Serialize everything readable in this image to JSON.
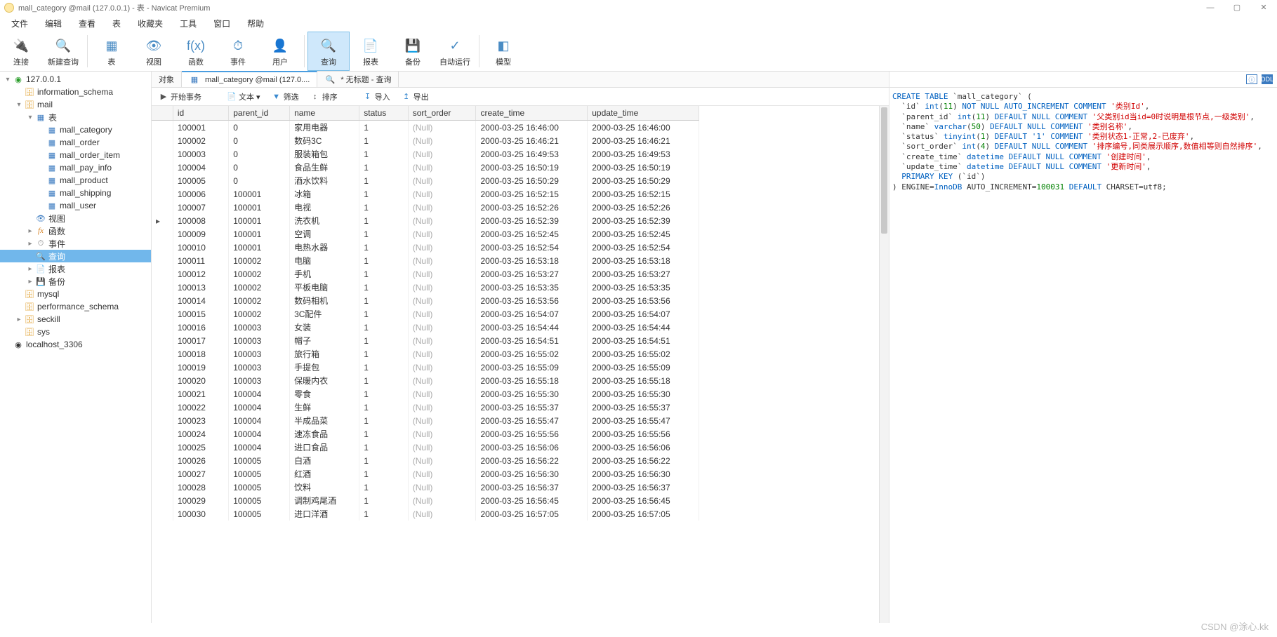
{
  "title": "mall_category @mail (127.0.0.1) - 表 - Navicat Premium",
  "menu": [
    "文件",
    "编辑",
    "查看",
    "表",
    "收藏夹",
    "工具",
    "窗口",
    "帮助"
  ],
  "toolbarBtns": [
    {
      "label": "连接",
      "icon": "🔌",
      "sel": false
    },
    {
      "label": "新建查询",
      "icon": "🔍",
      "sel": false
    },
    {
      "label": "表",
      "icon": "▦",
      "sel": false
    },
    {
      "label": "视图",
      "icon": "👁",
      "sel": false
    },
    {
      "label": "函数",
      "icon": "f(x)",
      "sel": false
    },
    {
      "label": "事件",
      "icon": "⏱",
      "sel": false
    },
    {
      "label": "用户",
      "icon": "👤",
      "sel": false
    },
    {
      "label": "查询",
      "icon": "🔍",
      "sel": true
    },
    {
      "label": "报表",
      "icon": "📄",
      "sel": false
    },
    {
      "label": "备份",
      "icon": "💾",
      "sel": false
    },
    {
      "label": "自动运行",
      "icon": "✓",
      "sel": false
    },
    {
      "label": "模型",
      "icon": "◧",
      "sel": false
    }
  ],
  "tree": [
    {
      "indent": 0,
      "tw": "▾",
      "cls": "conn-ic",
      "icon": "◉",
      "label": "127.0.0.1"
    },
    {
      "indent": 1,
      "tw": "",
      "cls": "db-ic",
      "icon": "🗄",
      "label": "information_schema"
    },
    {
      "indent": 1,
      "tw": "▾",
      "cls": "db-ic",
      "icon": "🗄",
      "label": "mail"
    },
    {
      "indent": 2,
      "tw": "▾",
      "cls": "tbl-ic",
      "icon": "▦",
      "label": "表"
    },
    {
      "indent": 3,
      "tw": "",
      "cls": "tbl-ic",
      "icon": "▦",
      "label": "mall_category"
    },
    {
      "indent": 3,
      "tw": "",
      "cls": "tbl-ic",
      "icon": "▦",
      "label": "mall_order"
    },
    {
      "indent": 3,
      "tw": "",
      "cls": "tbl-ic",
      "icon": "▦",
      "label": "mall_order_item"
    },
    {
      "indent": 3,
      "tw": "",
      "cls": "tbl-ic",
      "icon": "▦",
      "label": "mall_pay_info"
    },
    {
      "indent": 3,
      "tw": "",
      "cls": "tbl-ic",
      "icon": "▦",
      "label": "mall_product"
    },
    {
      "indent": 3,
      "tw": "",
      "cls": "tbl-ic",
      "icon": "▦",
      "label": "mall_shipping"
    },
    {
      "indent": 3,
      "tw": "",
      "cls": "tbl-ic",
      "icon": "▦",
      "label": "mall_user"
    },
    {
      "indent": 2,
      "tw": "",
      "cls": "view-ic",
      "icon": "👁",
      "label": "视图"
    },
    {
      "indent": 2,
      "tw": "▸",
      "cls": "func-ic",
      "icon": "fx",
      "label": "函数"
    },
    {
      "indent": 2,
      "tw": "▸",
      "cls": "evt-ic",
      "icon": "⏱",
      "label": "事件"
    },
    {
      "indent": 2,
      "tw": "",
      "cls": "qry-ic",
      "icon": "🔍",
      "label": "查询",
      "sel": true
    },
    {
      "indent": 2,
      "tw": "▸",
      "cls": "rpt-ic",
      "icon": "📄",
      "label": "报表"
    },
    {
      "indent": 2,
      "tw": "▸",
      "cls": "bkp-ic",
      "icon": "💾",
      "label": "备份"
    },
    {
      "indent": 1,
      "tw": "",
      "cls": "db-ic",
      "icon": "🗄",
      "label": "mysql"
    },
    {
      "indent": 1,
      "tw": "",
      "cls": "db-ic",
      "icon": "🗄",
      "label": "performance_schema"
    },
    {
      "indent": 1,
      "tw": "▸",
      "cls": "db-ic",
      "icon": "🗄",
      "label": "seckill"
    },
    {
      "indent": 1,
      "tw": "",
      "cls": "db-ic",
      "icon": "🗄",
      "label": "sys"
    },
    {
      "indent": 0,
      "tw": "",
      "cls": "",
      "icon": "◉",
      "label": "localhost_3306"
    }
  ],
  "tabs": [
    {
      "label": "对象",
      "active": false,
      "icon": ""
    },
    {
      "label": "mall_category @mail (127.0....",
      "active": true,
      "icon": "▦"
    },
    {
      "label": "* 无标题 - 查询",
      "active": false,
      "icon": "🔍"
    }
  ],
  "subButtons": [
    {
      "icon": "▶",
      "label": "开始事务"
    },
    {
      "icon": "📄",
      "label": "文本 ▾"
    },
    {
      "icon": "▼",
      "label": "筛选",
      "color": "#3a8ad0"
    },
    {
      "icon": "↕",
      "label": "排序"
    },
    {
      "icon": "↧",
      "label": "导入",
      "color": "#3a8ad0"
    },
    {
      "icon": "↥",
      "label": "导出",
      "color": "#3a8ad0"
    }
  ],
  "columns": [
    "id",
    "parent_id",
    "name",
    "status",
    "sort_order",
    "create_time",
    "update_time"
  ],
  "selectedRowId": "100008",
  "rows": [
    {
      "id": "100001",
      "parent_id": "0",
      "name": "家用电器",
      "status": "1",
      "sort_order": "(Null)",
      "create_time": "2000-03-25 16:46:00",
      "update_time": "2000-03-25 16:46:00"
    },
    {
      "id": "100002",
      "parent_id": "0",
      "name": "数码3C",
      "status": "1",
      "sort_order": "(Null)",
      "create_time": "2000-03-25 16:46:21",
      "update_time": "2000-03-25 16:46:21"
    },
    {
      "id": "100003",
      "parent_id": "0",
      "name": "服装箱包",
      "status": "1",
      "sort_order": "(Null)",
      "create_time": "2000-03-25 16:49:53",
      "update_time": "2000-03-25 16:49:53"
    },
    {
      "id": "100004",
      "parent_id": "0",
      "name": "食品生鲜",
      "status": "1",
      "sort_order": "(Null)",
      "create_time": "2000-03-25 16:50:19",
      "update_time": "2000-03-25 16:50:19"
    },
    {
      "id": "100005",
      "parent_id": "0",
      "name": "酒水饮料",
      "status": "1",
      "sort_order": "(Null)",
      "create_time": "2000-03-25 16:50:29",
      "update_time": "2000-03-25 16:50:29"
    },
    {
      "id": "100006",
      "parent_id": "100001",
      "name": "冰箱",
      "status": "1",
      "sort_order": "(Null)",
      "create_time": "2000-03-25 16:52:15",
      "update_time": "2000-03-25 16:52:15"
    },
    {
      "id": "100007",
      "parent_id": "100001",
      "name": "电视",
      "status": "1",
      "sort_order": "(Null)",
      "create_time": "2000-03-25 16:52:26",
      "update_time": "2000-03-25 16:52:26"
    },
    {
      "id": "100008",
      "parent_id": "100001",
      "name": "洗衣机",
      "status": "1",
      "sort_order": "(Null)",
      "create_time": "2000-03-25 16:52:39",
      "update_time": "2000-03-25 16:52:39"
    },
    {
      "id": "100009",
      "parent_id": "100001",
      "name": "空调",
      "status": "1",
      "sort_order": "(Null)",
      "create_time": "2000-03-25 16:52:45",
      "update_time": "2000-03-25 16:52:45"
    },
    {
      "id": "100010",
      "parent_id": "100001",
      "name": "电热水器",
      "status": "1",
      "sort_order": "(Null)",
      "create_time": "2000-03-25 16:52:54",
      "update_time": "2000-03-25 16:52:54"
    },
    {
      "id": "100011",
      "parent_id": "100002",
      "name": "电脑",
      "status": "1",
      "sort_order": "(Null)",
      "create_time": "2000-03-25 16:53:18",
      "update_time": "2000-03-25 16:53:18"
    },
    {
      "id": "100012",
      "parent_id": "100002",
      "name": "手机",
      "status": "1",
      "sort_order": "(Null)",
      "create_time": "2000-03-25 16:53:27",
      "update_time": "2000-03-25 16:53:27"
    },
    {
      "id": "100013",
      "parent_id": "100002",
      "name": "平板电脑",
      "status": "1",
      "sort_order": "(Null)",
      "create_time": "2000-03-25 16:53:35",
      "update_time": "2000-03-25 16:53:35"
    },
    {
      "id": "100014",
      "parent_id": "100002",
      "name": "数码相机",
      "status": "1",
      "sort_order": "(Null)",
      "create_time": "2000-03-25 16:53:56",
      "update_time": "2000-03-25 16:53:56"
    },
    {
      "id": "100015",
      "parent_id": "100002",
      "name": "3C配件",
      "status": "1",
      "sort_order": "(Null)",
      "create_time": "2000-03-25 16:54:07",
      "update_time": "2000-03-25 16:54:07"
    },
    {
      "id": "100016",
      "parent_id": "100003",
      "name": "女装",
      "status": "1",
      "sort_order": "(Null)",
      "create_time": "2000-03-25 16:54:44",
      "update_time": "2000-03-25 16:54:44"
    },
    {
      "id": "100017",
      "parent_id": "100003",
      "name": "帽子",
      "status": "1",
      "sort_order": "(Null)",
      "create_time": "2000-03-25 16:54:51",
      "update_time": "2000-03-25 16:54:51"
    },
    {
      "id": "100018",
      "parent_id": "100003",
      "name": "旅行箱",
      "status": "1",
      "sort_order": "(Null)",
      "create_time": "2000-03-25 16:55:02",
      "update_time": "2000-03-25 16:55:02"
    },
    {
      "id": "100019",
      "parent_id": "100003",
      "name": "手提包",
      "status": "1",
      "sort_order": "(Null)",
      "create_time": "2000-03-25 16:55:09",
      "update_time": "2000-03-25 16:55:09"
    },
    {
      "id": "100020",
      "parent_id": "100003",
      "name": "保暖内衣",
      "status": "1",
      "sort_order": "(Null)",
      "create_time": "2000-03-25 16:55:18",
      "update_time": "2000-03-25 16:55:18"
    },
    {
      "id": "100021",
      "parent_id": "100004",
      "name": "零食",
      "status": "1",
      "sort_order": "(Null)",
      "create_time": "2000-03-25 16:55:30",
      "update_time": "2000-03-25 16:55:30"
    },
    {
      "id": "100022",
      "parent_id": "100004",
      "name": "生鲜",
      "status": "1",
      "sort_order": "(Null)",
      "create_time": "2000-03-25 16:55:37",
      "update_time": "2000-03-25 16:55:37"
    },
    {
      "id": "100023",
      "parent_id": "100004",
      "name": "半成品菜",
      "status": "1",
      "sort_order": "(Null)",
      "create_time": "2000-03-25 16:55:47",
      "update_time": "2000-03-25 16:55:47"
    },
    {
      "id": "100024",
      "parent_id": "100004",
      "name": "速冻食品",
      "status": "1",
      "sort_order": "(Null)",
      "create_time": "2000-03-25 16:55:56",
      "update_time": "2000-03-25 16:55:56"
    },
    {
      "id": "100025",
      "parent_id": "100004",
      "name": "进口食品",
      "status": "1",
      "sort_order": "(Null)",
      "create_time": "2000-03-25 16:56:06",
      "update_time": "2000-03-25 16:56:06"
    },
    {
      "id": "100026",
      "parent_id": "100005",
      "name": "白酒",
      "status": "1",
      "sort_order": "(Null)",
      "create_time": "2000-03-25 16:56:22",
      "update_time": "2000-03-25 16:56:22"
    },
    {
      "id": "100027",
      "parent_id": "100005",
      "name": "红酒",
      "status": "1",
      "sort_order": "(Null)",
      "create_time": "2000-03-25 16:56:30",
      "update_time": "2000-03-25 16:56:30"
    },
    {
      "id": "100028",
      "parent_id": "100005",
      "name": "饮料",
      "status": "1",
      "sort_order": "(Null)",
      "create_time": "2000-03-25 16:56:37",
      "update_time": "2000-03-25 16:56:37"
    },
    {
      "id": "100029",
      "parent_id": "100005",
      "name": "调制鸡尾酒",
      "status": "1",
      "sort_order": "(Null)",
      "create_time": "2000-03-25 16:56:45",
      "update_time": "2000-03-25 16:56:45"
    },
    {
      "id": "100030",
      "parent_id": "100005",
      "name": "进口洋酒",
      "status": "1",
      "sort_order": "(Null)",
      "create_time": "2000-03-25 16:57:05",
      "update_time": "2000-03-25 16:57:05"
    }
  ],
  "ddl": {
    "table": "mall_category",
    "cols": [
      {
        "n": "id",
        "t": "int",
        "sz": "11",
        "extra": "NOT NULL AUTO_INCREMENT COMMENT",
        "c": "'类别Id'"
      },
      {
        "n": "parent_id",
        "t": "int",
        "sz": "11",
        "extra": "DEFAULT NULL COMMENT",
        "c": "'父类别id当id=0时说明是根节点,一级类别'"
      },
      {
        "n": "name",
        "t": "varchar",
        "sz": "50",
        "extra": "DEFAULT NULL COMMENT",
        "c": "'类别名称'"
      },
      {
        "n": "status",
        "t": "tinyint",
        "sz": "1",
        "extra": "DEFAULT '1' COMMENT",
        "c": "'类别状态1-正常,2-已废弃'"
      },
      {
        "n": "sort_order",
        "t": "int",
        "sz": "4",
        "extra": "DEFAULT NULL COMMENT",
        "c": "'排序编号,同类展示顺序,数值相等则自然排序'"
      },
      {
        "n": "create_time",
        "t": "datetime",
        "sz": "",
        "extra": "DEFAULT NULL COMMENT",
        "c": "'创建时间'"
      },
      {
        "n": "update_time",
        "t": "datetime",
        "sz": "",
        "extra": "DEFAULT NULL COMMENT",
        "c": "'更新时间'"
      }
    ],
    "pk": "id",
    "engine": "InnoDB",
    "autoinc": "100031",
    "charset": "utf8"
  },
  "watermark": "CSDN @涂心.kk"
}
